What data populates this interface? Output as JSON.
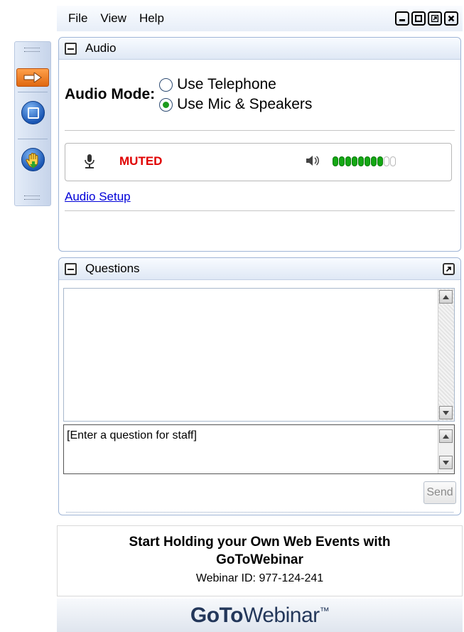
{
  "menu": {
    "items": [
      "File",
      "View",
      "Help"
    ]
  },
  "window_buttons": [
    "minimize",
    "maximize",
    "restore",
    "close"
  ],
  "audio": {
    "title": "Audio",
    "mode_label": "Audio Mode:",
    "options": [
      {
        "label": "Use Telephone",
        "selected": false
      },
      {
        "label": "Use Mic & Speakers",
        "selected": true
      }
    ],
    "mic_status": "MUTED",
    "speaker_level": {
      "lit": 8,
      "total": 10
    },
    "setup_link": "Audio Setup"
  },
  "questions": {
    "title": "Questions",
    "input_placeholder": "[Enter a question for staff]",
    "send_label": "Send"
  },
  "promo": {
    "headline_line1": "Start Holding your Own Web Events with",
    "headline_line2": "GoToWebinar",
    "webinar_id": "Webinar ID: 977-124-241"
  },
  "brand": {
    "part1": "GoTo",
    "part2": "Webinar",
    "tm": "™"
  },
  "colors": {
    "muted": "#e00000",
    "meter_on": "#14a814",
    "link": "#0000d8",
    "accent_orange": "#f07a20"
  }
}
